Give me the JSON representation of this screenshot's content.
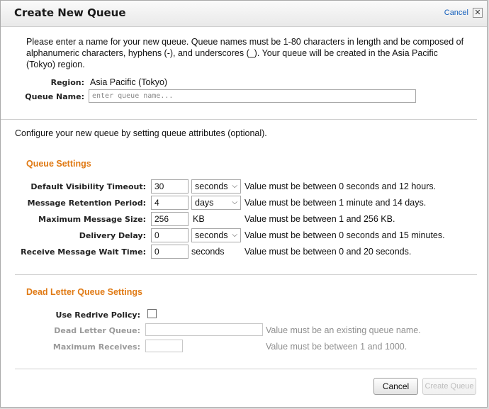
{
  "dialog": {
    "title": "Create New Queue",
    "cancel_link": "Cancel",
    "close_glyph": "✕"
  },
  "intro_text": "Please enter a name for your new queue. Queue names must be 1-80 characters in length and be composed of alphanumeric characters, hyphens (-), and underscores (_). Your queue will be created in the Asia Pacific (Tokyo) region.",
  "region": {
    "label": "Region:",
    "value": "Asia Pacific (Tokyo)"
  },
  "queue_name": {
    "label": "Queue Name:",
    "placeholder": "enter queue name...",
    "value": ""
  },
  "configure_text": "Configure your new queue by setting queue attributes (optional).",
  "queue_settings": {
    "title": "Queue Settings",
    "rows": [
      {
        "label": "Default Visibility Timeout:",
        "value": "30",
        "unit": "seconds",
        "unit_type": "select",
        "hint": "Value must be between 0 seconds and 12 hours."
      },
      {
        "label": "Message Retention Period:",
        "value": "4",
        "unit": "days",
        "unit_type": "select",
        "hint": "Value must be between 1 minute and 14 days."
      },
      {
        "label": "Maximum Message Size:",
        "value": "256",
        "unit": "KB",
        "unit_type": "text",
        "hint": "Value must be between 1 and 256 KB."
      },
      {
        "label": "Delivery Delay:",
        "value": "0",
        "unit": "seconds",
        "unit_type": "select",
        "hint": "Value must be between 0 seconds and 15 minutes."
      },
      {
        "label": "Receive Message Wait Time:",
        "value": "0",
        "unit": "seconds",
        "unit_type": "text",
        "hint": "Value must be between 0 and 20 seconds."
      }
    ]
  },
  "dead_letter": {
    "title": "Dead Letter Queue Settings",
    "use_redrive_label": "Use Redrive Policy:",
    "use_redrive_checked": false,
    "dead_letter_queue_label": "Dead Letter Queue:",
    "dead_letter_queue_value": "",
    "dead_letter_queue_hint": "Value must be an existing queue name.",
    "max_receives_label": "Maximum Receives:",
    "max_receives_value": "",
    "max_receives_hint": "Value must be between 1 and 1000."
  },
  "footer": {
    "cancel_button": "Cancel",
    "create_button": "Create Queue"
  },
  "colors": {
    "section_title": "#e07a14",
    "link": "#1560bd",
    "disabled_text": "#9a9a9a"
  }
}
